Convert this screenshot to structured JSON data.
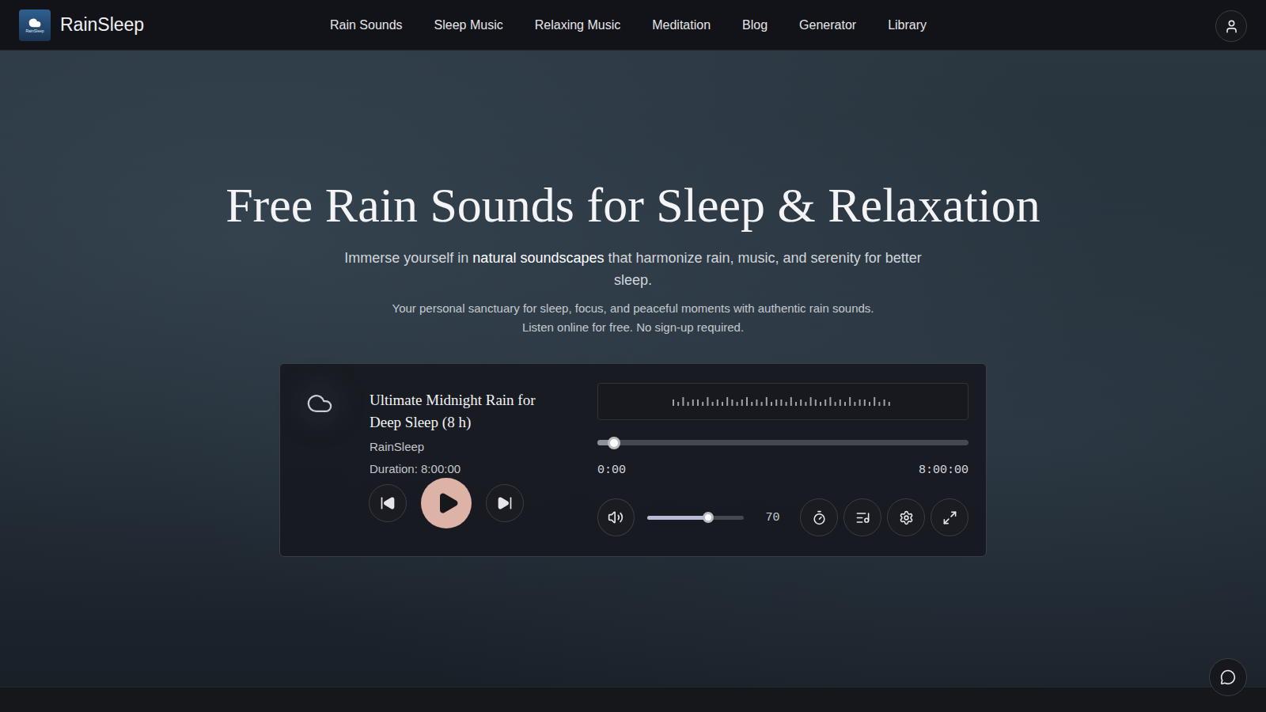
{
  "brand": {
    "name": "RainSleep",
    "logo_caption": "RainSleep"
  },
  "nav": [
    {
      "label": "Rain Sounds"
    },
    {
      "label": "Sleep Music"
    },
    {
      "label": "Relaxing Music"
    },
    {
      "label": "Meditation"
    },
    {
      "label": "Blog"
    },
    {
      "label": "Generator"
    },
    {
      "label": "Library"
    }
  ],
  "hero": {
    "title": "Free Rain Sounds for Sleep & Relaxation",
    "subtitle_before": "Immerse yourself in ",
    "subtitle_highlight": "natural soundscapes",
    "subtitle_after": " that harmonize rain, music, and serenity for better sleep.",
    "lines": [
      "Your personal sanctuary for sleep, focus, and peaceful moments with authentic rain sounds.",
      "Listen online for free. No sign-up required."
    ]
  },
  "player": {
    "title": "Ultimate Midnight Rain for Deep Sleep (8 h)",
    "artist": "RainSleep",
    "duration": "Duration: 8:00:00",
    "playing": false,
    "waveform": [
      2,
      1,
      3,
      1,
      2,
      2,
      1,
      3,
      1,
      2,
      1,
      3,
      2,
      1,
      2,
      3,
      1,
      2,
      1,
      3,
      1,
      2,
      2,
      1,
      3,
      1,
      2,
      1,
      3,
      2,
      1,
      2,
      3,
      1,
      2,
      1,
      3,
      1,
      2,
      2,
      1,
      3,
      1,
      2,
      1
    ],
    "progress": {
      "level": 0.045,
      "elapsed": "0:00",
      "total": "8:00:00"
    },
    "volume": {
      "level": 0.63,
      "reading": "70"
    }
  }
}
